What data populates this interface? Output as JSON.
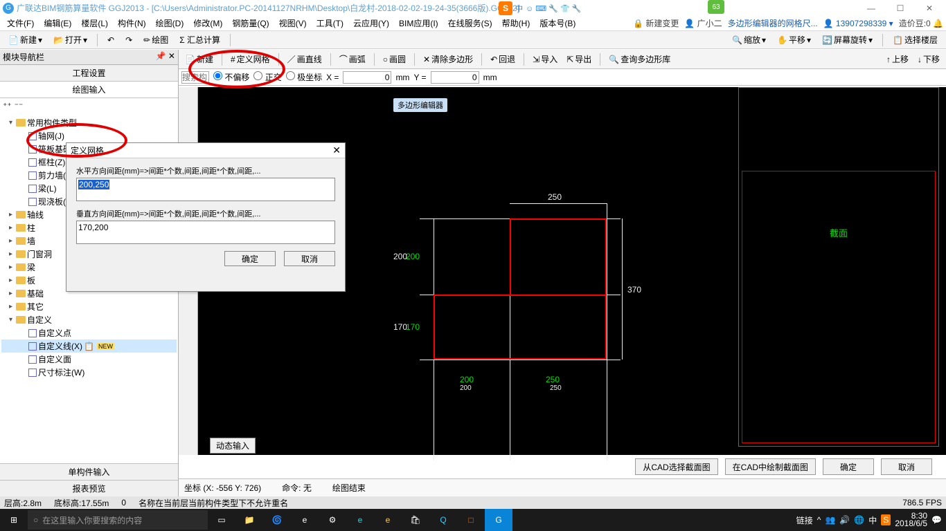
{
  "title": "广联达BIM钢筋算量软件 GGJ2013 - [C:\\Users\\Administrator.PC-20141127NRHM\\Desktop\\白龙村-2018-02-02-19-24-35(3666版).GGJ12]",
  "green_badge": "63",
  "sogou_text": "中",
  "sogou_icons": "☺ ⌨ 🔧 👕 🔧",
  "menu": [
    "文件(F)",
    "编辑(E)",
    "楼层(L)",
    "构件(N)",
    "绘图(D)",
    "修改(M)",
    "钢筋量(Q)",
    "视图(V)",
    "工具(T)",
    "云应用(Y)",
    "BIM应用(I)",
    "在线服务(S)",
    "帮助(H)",
    "版本号(B)"
  ],
  "menu_right": {
    "new_change": "🔒 新建变更",
    "user": "👤 广小二",
    "poly_hint": "多边形编辑器的网格尺...",
    "phone": "👤 13907298339 ▾",
    "coin": "造价豆:0 🔔"
  },
  "tb1": {
    "new": "新建",
    "open": "打开",
    "undo": "↶",
    "redo": "↷",
    "draw": "绘图",
    "sum": "Σ 汇总计算",
    "zoom": "缩放",
    "pan": "平移",
    "rotate": "屏幕旋转",
    "floor": "选择楼层"
  },
  "left": {
    "header": "模块导航栏",
    "pin": "📌 ✕",
    "t1": "工程设置",
    "t2": "绘图输入",
    "bottom1": "单构件输入",
    "bottom2": "报表预览"
  },
  "tree": [
    {
      "ind": 0,
      "exp": "▾",
      "ic": "folder",
      "label": "常用构件类型"
    },
    {
      "ind": 1,
      "exp": "",
      "ic": "item",
      "label": "轴网(J)"
    },
    {
      "ind": 1,
      "exp": "",
      "ic": "item",
      "label": "筏板基础(M)"
    },
    {
      "ind": 1,
      "exp": "",
      "ic": "item",
      "label": "框柱(Z)"
    },
    {
      "ind": 1,
      "exp": "",
      "ic": "item",
      "label": "剪力墙(Q)"
    },
    {
      "ind": 1,
      "exp": "",
      "ic": "item",
      "label": "梁(L)"
    },
    {
      "ind": 1,
      "exp": "",
      "ic": "item",
      "label": "现浇板(B)"
    },
    {
      "ind": 0,
      "exp": "▸",
      "ic": "folder",
      "label": "轴线"
    },
    {
      "ind": 0,
      "exp": "▸",
      "ic": "folder",
      "label": "柱"
    },
    {
      "ind": 0,
      "exp": "▸",
      "ic": "folder",
      "label": "墙"
    },
    {
      "ind": 0,
      "exp": "▸",
      "ic": "folder",
      "label": "门窗洞"
    },
    {
      "ind": 0,
      "exp": "▸",
      "ic": "folder",
      "label": "梁"
    },
    {
      "ind": 0,
      "exp": "▸",
      "ic": "folder",
      "label": "板"
    },
    {
      "ind": 0,
      "exp": "▸",
      "ic": "folder",
      "label": "基础"
    },
    {
      "ind": 0,
      "exp": "▸",
      "ic": "folder",
      "label": "其它"
    },
    {
      "ind": 0,
      "exp": "▾",
      "ic": "folder",
      "label": "自定义"
    },
    {
      "ind": 1,
      "exp": "",
      "ic": "item",
      "label": "自定义点"
    },
    {
      "ind": 1,
      "exp": "",
      "ic": "item",
      "label": "自定义线(X)",
      "hl": true,
      "new": true
    },
    {
      "ind": 1,
      "exp": "",
      "ic": "item",
      "label": "自定义面"
    },
    {
      "ind": 1,
      "exp": "",
      "ic": "item",
      "label": "尺寸标注(W)"
    }
  ],
  "poly_popup": "多边形编辑器",
  "poly_tb": {
    "new": "新建",
    "grid": "定义网格",
    "line": "画直线",
    "arc": "画弧",
    "circle": "画圆",
    "clear": "清除多边形",
    "back": "回退",
    "import": "导入",
    "export": "导出",
    "query": "查询多边形库",
    "up": "上移",
    "down": "下移"
  },
  "poly_row2": {
    "search": "搜索构…",
    "mode1": "不偏移",
    "mode2": "正交",
    "mode3": "极坐标",
    "x": "X =",
    "xv": "0",
    "mm1": "mm",
    "y": "Y =",
    "yv": "0",
    "mm2": "mm"
  },
  "dialog": {
    "title": "定义网格",
    "l1": "水平方向间距(mm)=>间距*个数,间距,间距*个数,间距,...",
    "v1": "200,250",
    "l2": "垂直方向间距(mm)=>间距*个数,间距,间距*个数,间距,...",
    "v2": "170,200",
    "ok": "确定",
    "cancel": "取消"
  },
  "canvas": {
    "top": "250",
    "right": "370",
    "g200": "200",
    "g170": "170",
    "w200": "200",
    "w170": "170",
    "b200": "200",
    "b250": "250",
    "b250s": "250"
  },
  "dyn": "动态输入",
  "btns": {
    "b1": "从CAD选择截面图",
    "b2": "在CAD中绘制截面图",
    "ok": "确定",
    "cancel": "取消"
  },
  "status": {
    "coord": "坐标 (X: -556 Y: 726)",
    "cmd": "命令: 无",
    "draw": "绘图结束"
  },
  "preview_text": "截面",
  "bottom": {
    "floor": "层高:2.8m",
    "bot": "底标高:17.55m",
    "zero": "0",
    "name": "名称在当前层当前构件类型下不允许重名",
    "fps": "786.5 FPS"
  },
  "task": {
    "search": "在这里输入你要搜索的内容",
    "link": "链接",
    "time": "8:30",
    "date": "2018/6/5"
  }
}
